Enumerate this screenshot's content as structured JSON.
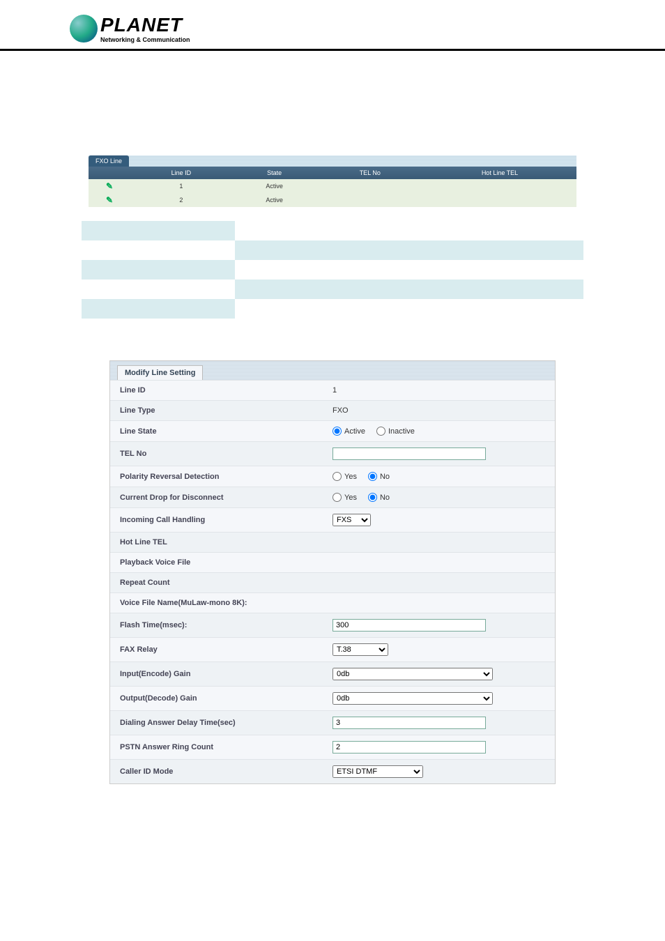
{
  "logo": {
    "brand": "PLANET",
    "tagline": "Networking & Communication"
  },
  "fxo": {
    "tab": "FXO Line",
    "headers": [
      "",
      "Line ID",
      "State",
      "TEL No",
      "Hot Line TEL"
    ],
    "rows": [
      {
        "line_id": "1",
        "state": "Active",
        "tel": "",
        "hot": ""
      },
      {
        "line_id": "2",
        "state": "Active",
        "tel": "",
        "hot": ""
      }
    ]
  },
  "kv": [
    {
      "k": "",
      "v": ""
    },
    {
      "k": "",
      "v": ""
    },
    {
      "k": "",
      "v": ""
    },
    {
      "k": "",
      "v": ""
    },
    {
      "k": "",
      "v": ""
    }
  ],
  "modify": {
    "title": "Modify Line Setting",
    "line_id": {
      "label": "Line ID",
      "value": "1"
    },
    "line_type": {
      "label": "Line Type",
      "value": "FXO"
    },
    "line_state": {
      "label": "Line State",
      "active": "Active",
      "inactive": "Inactive",
      "checked": "active"
    },
    "tel_no": {
      "label": "TEL No",
      "value": ""
    },
    "polarity": {
      "label": "Polarity Reversal Detection",
      "yes": "Yes",
      "no": "No",
      "checked": "no"
    },
    "current_drop": {
      "label": "Current Drop for Disconnect",
      "yes": "Yes",
      "no": "No",
      "checked": "no"
    },
    "incoming": {
      "label": "Incoming Call Handling",
      "value": "FXS"
    },
    "hotline": {
      "label": "Hot Line TEL",
      "value": ""
    },
    "playback": {
      "label": "Playback Voice File",
      "value": ""
    },
    "repeat": {
      "label": "Repeat Count",
      "value": ""
    },
    "voicefile": {
      "label": "Voice File Name(MuLaw-mono 8K):",
      "value": ""
    },
    "flash": {
      "label": "Flash Time(msec):",
      "value": "300"
    },
    "fax": {
      "label": "FAX Relay",
      "value": "T.38"
    },
    "in_gain": {
      "label": "Input(Encode) Gain",
      "value": "0db"
    },
    "out_gain": {
      "label": "Output(Decode) Gain",
      "value": "0db"
    },
    "dial_delay": {
      "label": "Dialing Answer Delay Time(sec)",
      "value": "3"
    },
    "ring_count": {
      "label": "PSTN Answer Ring Count",
      "value": "2"
    },
    "cid": {
      "label": "Caller ID Mode",
      "value": "ETSI DTMF"
    }
  }
}
